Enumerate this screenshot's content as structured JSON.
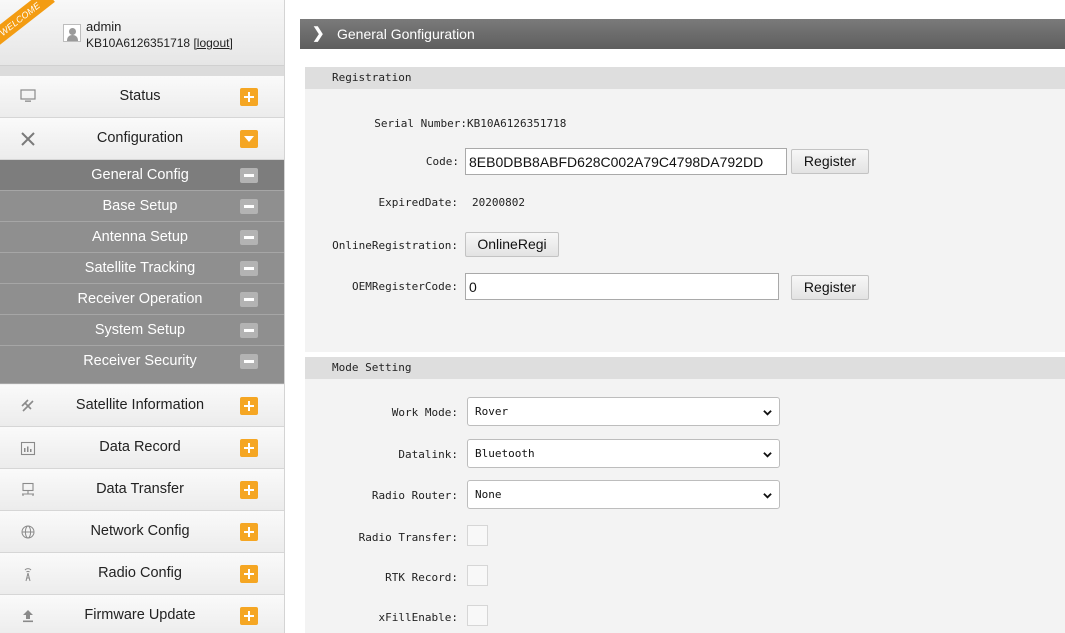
{
  "user": {
    "welcome_ribbon": "WELCOME",
    "name": "admin",
    "serial": "KB10A6126351718",
    "logout": "[logout]"
  },
  "sidebar": {
    "items": [
      {
        "label": "Status",
        "icon": "monitor-icon",
        "state": "collapsed"
      },
      {
        "label": "Configuration",
        "icon": "tools-icon",
        "state": "expanded"
      },
      {
        "label": "Satellite Information",
        "icon": "satellite-icon",
        "state": "collapsed"
      },
      {
        "label": "Data Record",
        "icon": "calendar-icon",
        "state": "collapsed"
      },
      {
        "label": "Data Transfer",
        "icon": "network-icon",
        "state": "collapsed"
      },
      {
        "label": "Network Config",
        "icon": "globe-icon",
        "state": "collapsed"
      },
      {
        "label": "Radio Config",
        "icon": "antenna-icon",
        "state": "collapsed"
      },
      {
        "label": "Firmware Update",
        "icon": "upload-icon",
        "state": "collapsed"
      }
    ],
    "sub_items": [
      {
        "label": "General Config",
        "active": true
      },
      {
        "label": "Base Setup"
      },
      {
        "label": "Antenna Setup"
      },
      {
        "label": "Satellite Tracking"
      },
      {
        "label": "Receiver Operation"
      },
      {
        "label": "System Setup"
      },
      {
        "label": "Receiver Security"
      }
    ]
  },
  "header": {
    "title": "General Gonfiguration"
  },
  "registration": {
    "section_title": "Registration",
    "serial_label": "Serial Number:",
    "serial_value": "KB10A6126351718",
    "code_label": "Code:",
    "code_value": "8EB0DBB8ABFD628C002A79C4798DA792DD",
    "register_button": "Register",
    "expired_label": "ExpiredDate:",
    "expired_value": "20200802",
    "online_label": "OnlineRegistration:",
    "online_button": "OnlineRegi",
    "oem_label": "OEMRegisterCode:",
    "oem_value": "0",
    "oem_register_button": "Register"
  },
  "mode": {
    "section_title": "Mode Setting",
    "work_mode_label": "Work Mode:",
    "work_mode_value": "Rover",
    "datalink_label": "Datalink:",
    "datalink_value": "Bluetooth",
    "radio_router_label": "Radio Router:",
    "radio_router_value": "None",
    "radio_transfer_label": "Radio Transfer:",
    "rtk_record_label": "RTK Record:",
    "xfill_label": "xFillEnable:"
  },
  "colors": {
    "accent": "#f5a623",
    "header": "#6b6b6b",
    "submenu": "#8f8f8f"
  }
}
